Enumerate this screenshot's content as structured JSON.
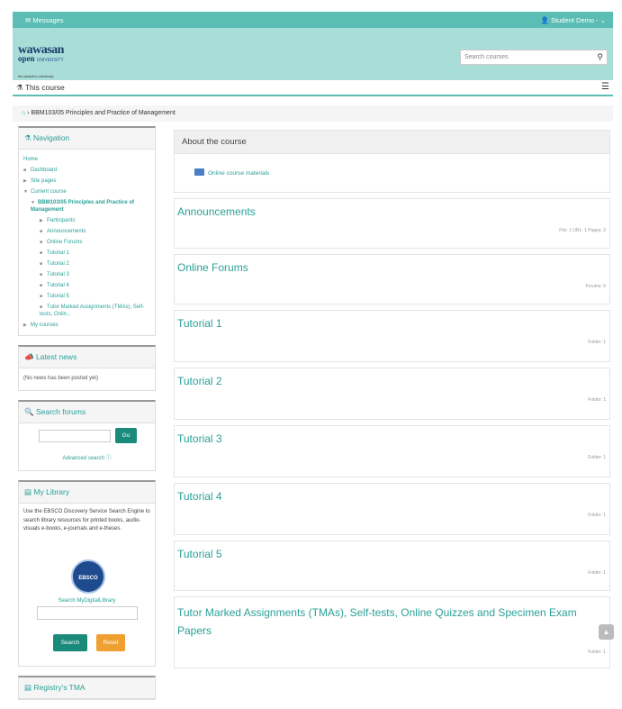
{
  "topbar": {
    "messages": "Messages",
    "user": "Student Demo -"
  },
  "logo": {
    "line1": "wawasan",
    "line2": "open",
    "line2b": "UNIVERSITY",
    "tagline": "the people's university"
  },
  "search": {
    "placeholder": "Search courses"
  },
  "coursebar": {
    "label": "This course"
  },
  "breadcrumb": {
    "course": "BBM103/05 Principles and Practice of Management"
  },
  "navigation": {
    "title": "Navigation",
    "home": "Home",
    "dashboard": "Dashboard",
    "site_pages": "Site pages",
    "current_course": "Current course",
    "course_name": "BBM103/05 Principles and Practice of Management",
    "items": [
      "Participants",
      "Announcements",
      "Online Forums",
      "Tutorial 1",
      "Tutorial 2",
      "Tutorial 3",
      "Tutorial 4",
      "Tutorial 5",
      "Tutor Marked Assignments (TMAs), Self-tests, Onlin..."
    ],
    "my_courses": "My courses"
  },
  "latest_news": {
    "title": "Latest news",
    "body": "(No news has been posted yet)"
  },
  "search_forums": {
    "title": "Search forums",
    "go": "Go",
    "advanced": "Advanced search"
  },
  "library": {
    "title": "My Library",
    "desc": "Use the EBSCO Discovery Service Search Engine to search library resources for printed books, audio-visuals e-books, e-journals and e-theses.",
    "logo": "EBSCO",
    "label": "Search MyDigitalLibrary",
    "search": "Search",
    "reset": "Reset"
  },
  "registry": {
    "title": "Registry's TMA"
  },
  "main": {
    "about_title": "About the course",
    "about_item": "Online course materials",
    "sections": [
      {
        "title": "Announcements",
        "meta": "File: 1  URL: 1  Pages: 2"
      },
      {
        "title": "Online Forums",
        "meta": "Forums: 5"
      },
      {
        "title": "Tutorial 1",
        "meta": "Folder: 1"
      },
      {
        "title": "Tutorial 2",
        "meta": "Folder: 1"
      },
      {
        "title": "Tutorial 3",
        "meta": "Folder: 1"
      },
      {
        "title": "Tutorial 4",
        "meta": "Folder: 1"
      },
      {
        "title": "Tutorial 5",
        "meta": "Folder: 1"
      },
      {
        "title": "Tutor Marked Assignments (TMAs), Self-tests, Online Quizzes and Specimen Exam Papers",
        "meta": "Folder: 1"
      }
    ]
  },
  "colors": {
    "teal": "#5bbdb4",
    "header_bg": "#a8ddd8",
    "link": "#2aa198",
    "reset": "#f0a030",
    "button": "#1a8a7a"
  }
}
